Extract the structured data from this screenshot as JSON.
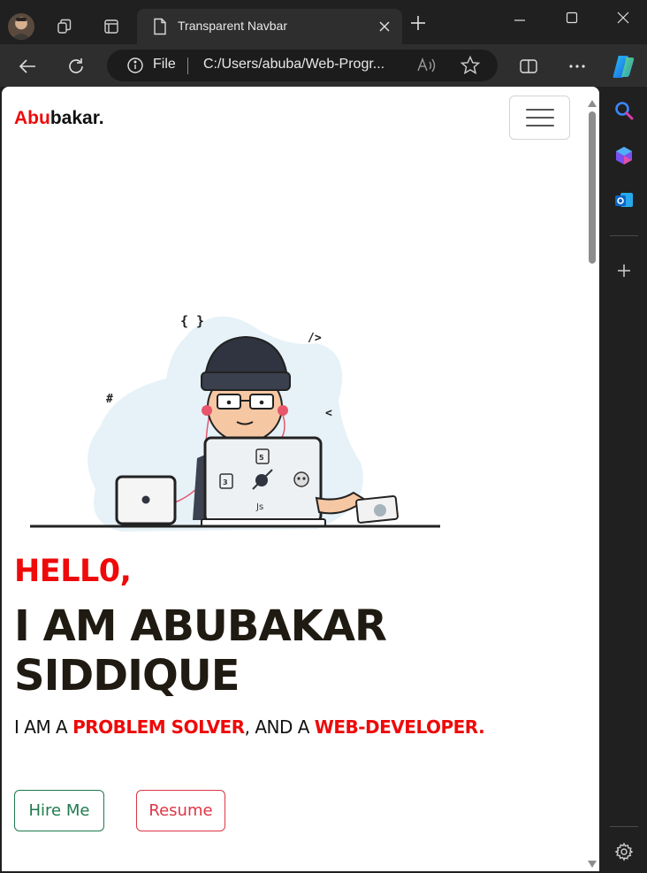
{
  "browser": {
    "tab_title": "Transparent Navbar",
    "address_scheme_label": "File",
    "url": "C:/Users/abuba/Web-Progr...",
    "icons": {
      "profile": "profile-avatar",
      "workspaces": "workspaces-icon",
      "tab_actions": "tab-actions-icon",
      "page": "page-icon",
      "close_tab": "close-icon",
      "new_tab": "plus-icon",
      "minimize": "minimize-icon",
      "maximize": "maximize-icon",
      "close_window": "close-icon",
      "back": "back-arrow-icon",
      "refresh": "refresh-icon",
      "info": "info-icon",
      "read_aloud": "read-aloud-icon",
      "favorite": "star-icon",
      "split_screen": "split-screen-icon",
      "more": "more-icon",
      "copilot": "copilot-icon"
    }
  },
  "sidebar": {
    "icons": [
      "search-icon",
      "copilot-designer-icon",
      "outlook-icon",
      "add-icon",
      "settings-icon"
    ]
  },
  "page": {
    "brand": {
      "accent": "Abu",
      "rest": "bakar."
    },
    "hero": {
      "greeting": "HELL0,",
      "name": "I AM ABUBAKAR SIDDIQUE",
      "tagline_prefix": "I AM A ",
      "highlight_1": "PROBLEM SOLVER",
      "tagline_mid": ", AND A ",
      "highlight_2": "WEB-DEVELOPER."
    },
    "illustration_labels": {
      "braces": "{ }",
      "slash_tag": "/>",
      "hash": "#",
      "chevron": "<",
      "js": "Js"
    },
    "buttons": {
      "hire": "Hire Me",
      "resume": "Resume"
    }
  },
  "colors": {
    "accent_red": "#ee0a0a",
    "hire_green": "#1f7a4d",
    "resume_red": "#dc3545",
    "browser_dark": "#202020"
  }
}
